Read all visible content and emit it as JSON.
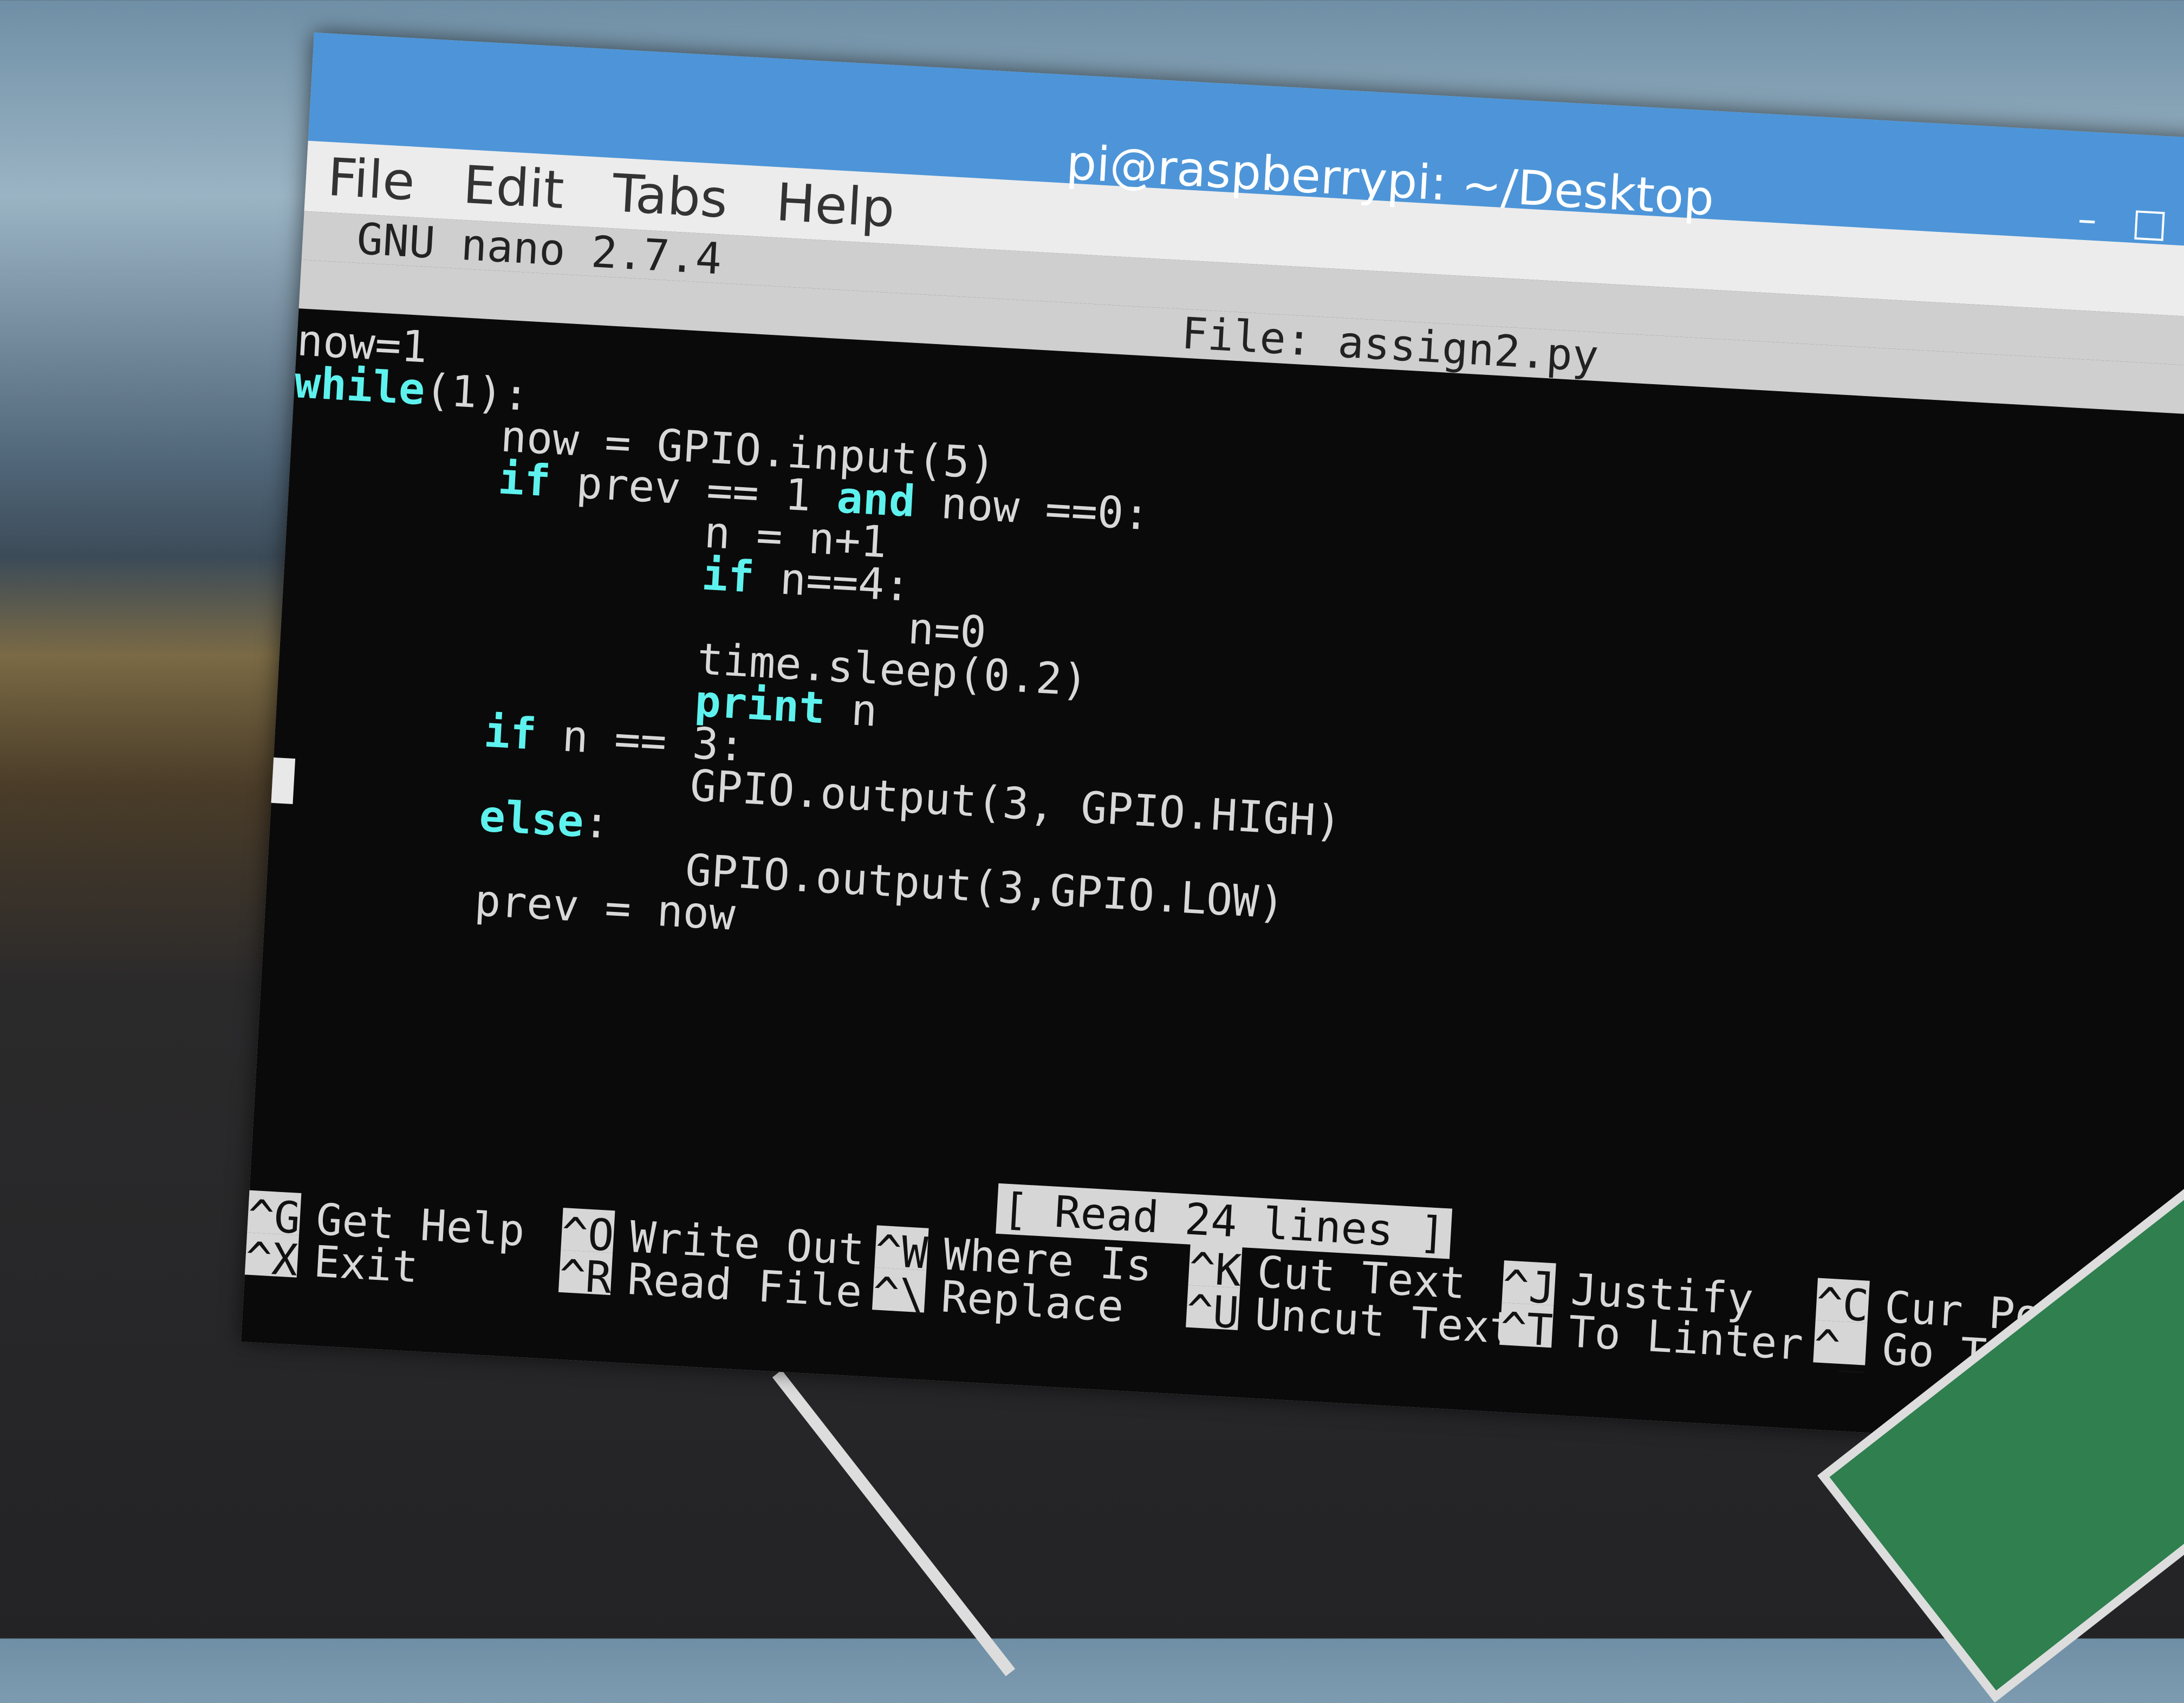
{
  "window": {
    "title": "pi@raspberrypi: ~/Desktop",
    "minimize": "–",
    "maximize": "□"
  },
  "menu": [
    "File",
    "Edit",
    "Tabs",
    "Help"
  ],
  "nano": {
    "version": "GNU nano 2.7.4",
    "file": "File: assign2.py",
    "status": "[ Read 24 lines ]"
  },
  "code": {
    "lines": [
      [
        {
          "t": "now=1"
        }
      ],
      [
        {
          "t": "while",
          "k": 1
        },
        {
          "t": "(1):"
        }
      ],
      [
        {
          "t": "        now = GPIO.input(5)"
        }
      ],
      [
        {
          "t": "        "
        },
        {
          "t": "if",
          "k": 1
        },
        {
          "t": " prev == 1 "
        },
        {
          "t": "and",
          "k": 1
        },
        {
          "t": " now ==0:"
        }
      ],
      [
        {
          "t": "                n = n+1"
        }
      ],
      [
        {
          "t": "                "
        },
        {
          "t": "if",
          "k": 1
        },
        {
          "t": " n==4:"
        }
      ],
      [
        {
          "t": "                        n=0"
        }
      ],
      [
        {
          "t": "                time.sleep(0.2)"
        }
      ],
      [
        {
          "t": "                "
        },
        {
          "t": "print",
          "k": 1
        },
        {
          "t": " n"
        }
      ],
      [
        {
          "t": "        "
        },
        {
          "t": "if",
          "k": 1
        },
        {
          "t": " n == 3:"
        }
      ],
      [
        {
          "t": "                GPIO.output(3, GPIO.HIGH)"
        }
      ],
      [
        {
          "t": "        "
        },
        {
          "t": "else",
          "k": 1
        },
        {
          "t": ":"
        }
      ],
      [
        {
          "t": "                GPIO.output(3,GPIO.LOW)"
        }
      ],
      [
        {
          "t": "        prev = now"
        }
      ]
    ]
  },
  "shortcuts": [
    {
      "key": "^G",
      "label": "Get Help"
    },
    {
      "key": "^O",
      "label": "Write Out"
    },
    {
      "key": "^W",
      "label": "Where Is"
    },
    {
      "key": "^K",
      "label": "Cut Text"
    },
    {
      "key": "^J",
      "label": "Justify"
    },
    {
      "key": "^C",
      "label": "Cur Pos"
    },
    {
      "key": "^X",
      "label": "Exit"
    },
    {
      "key": "^R",
      "label": "Read File"
    },
    {
      "key": "^\\",
      "label": "Replace"
    },
    {
      "key": "^U",
      "label": "Uncut Text"
    },
    {
      "key": "^T",
      "label": "To Linter"
    },
    {
      "key": "^_",
      "label": "Go To Line"
    }
  ],
  "colors": {
    "titlebar": "#4d95d8",
    "keyword": "#5ef2ee",
    "text": "#d8d8d8",
    "background": "#0a0a0a"
  }
}
